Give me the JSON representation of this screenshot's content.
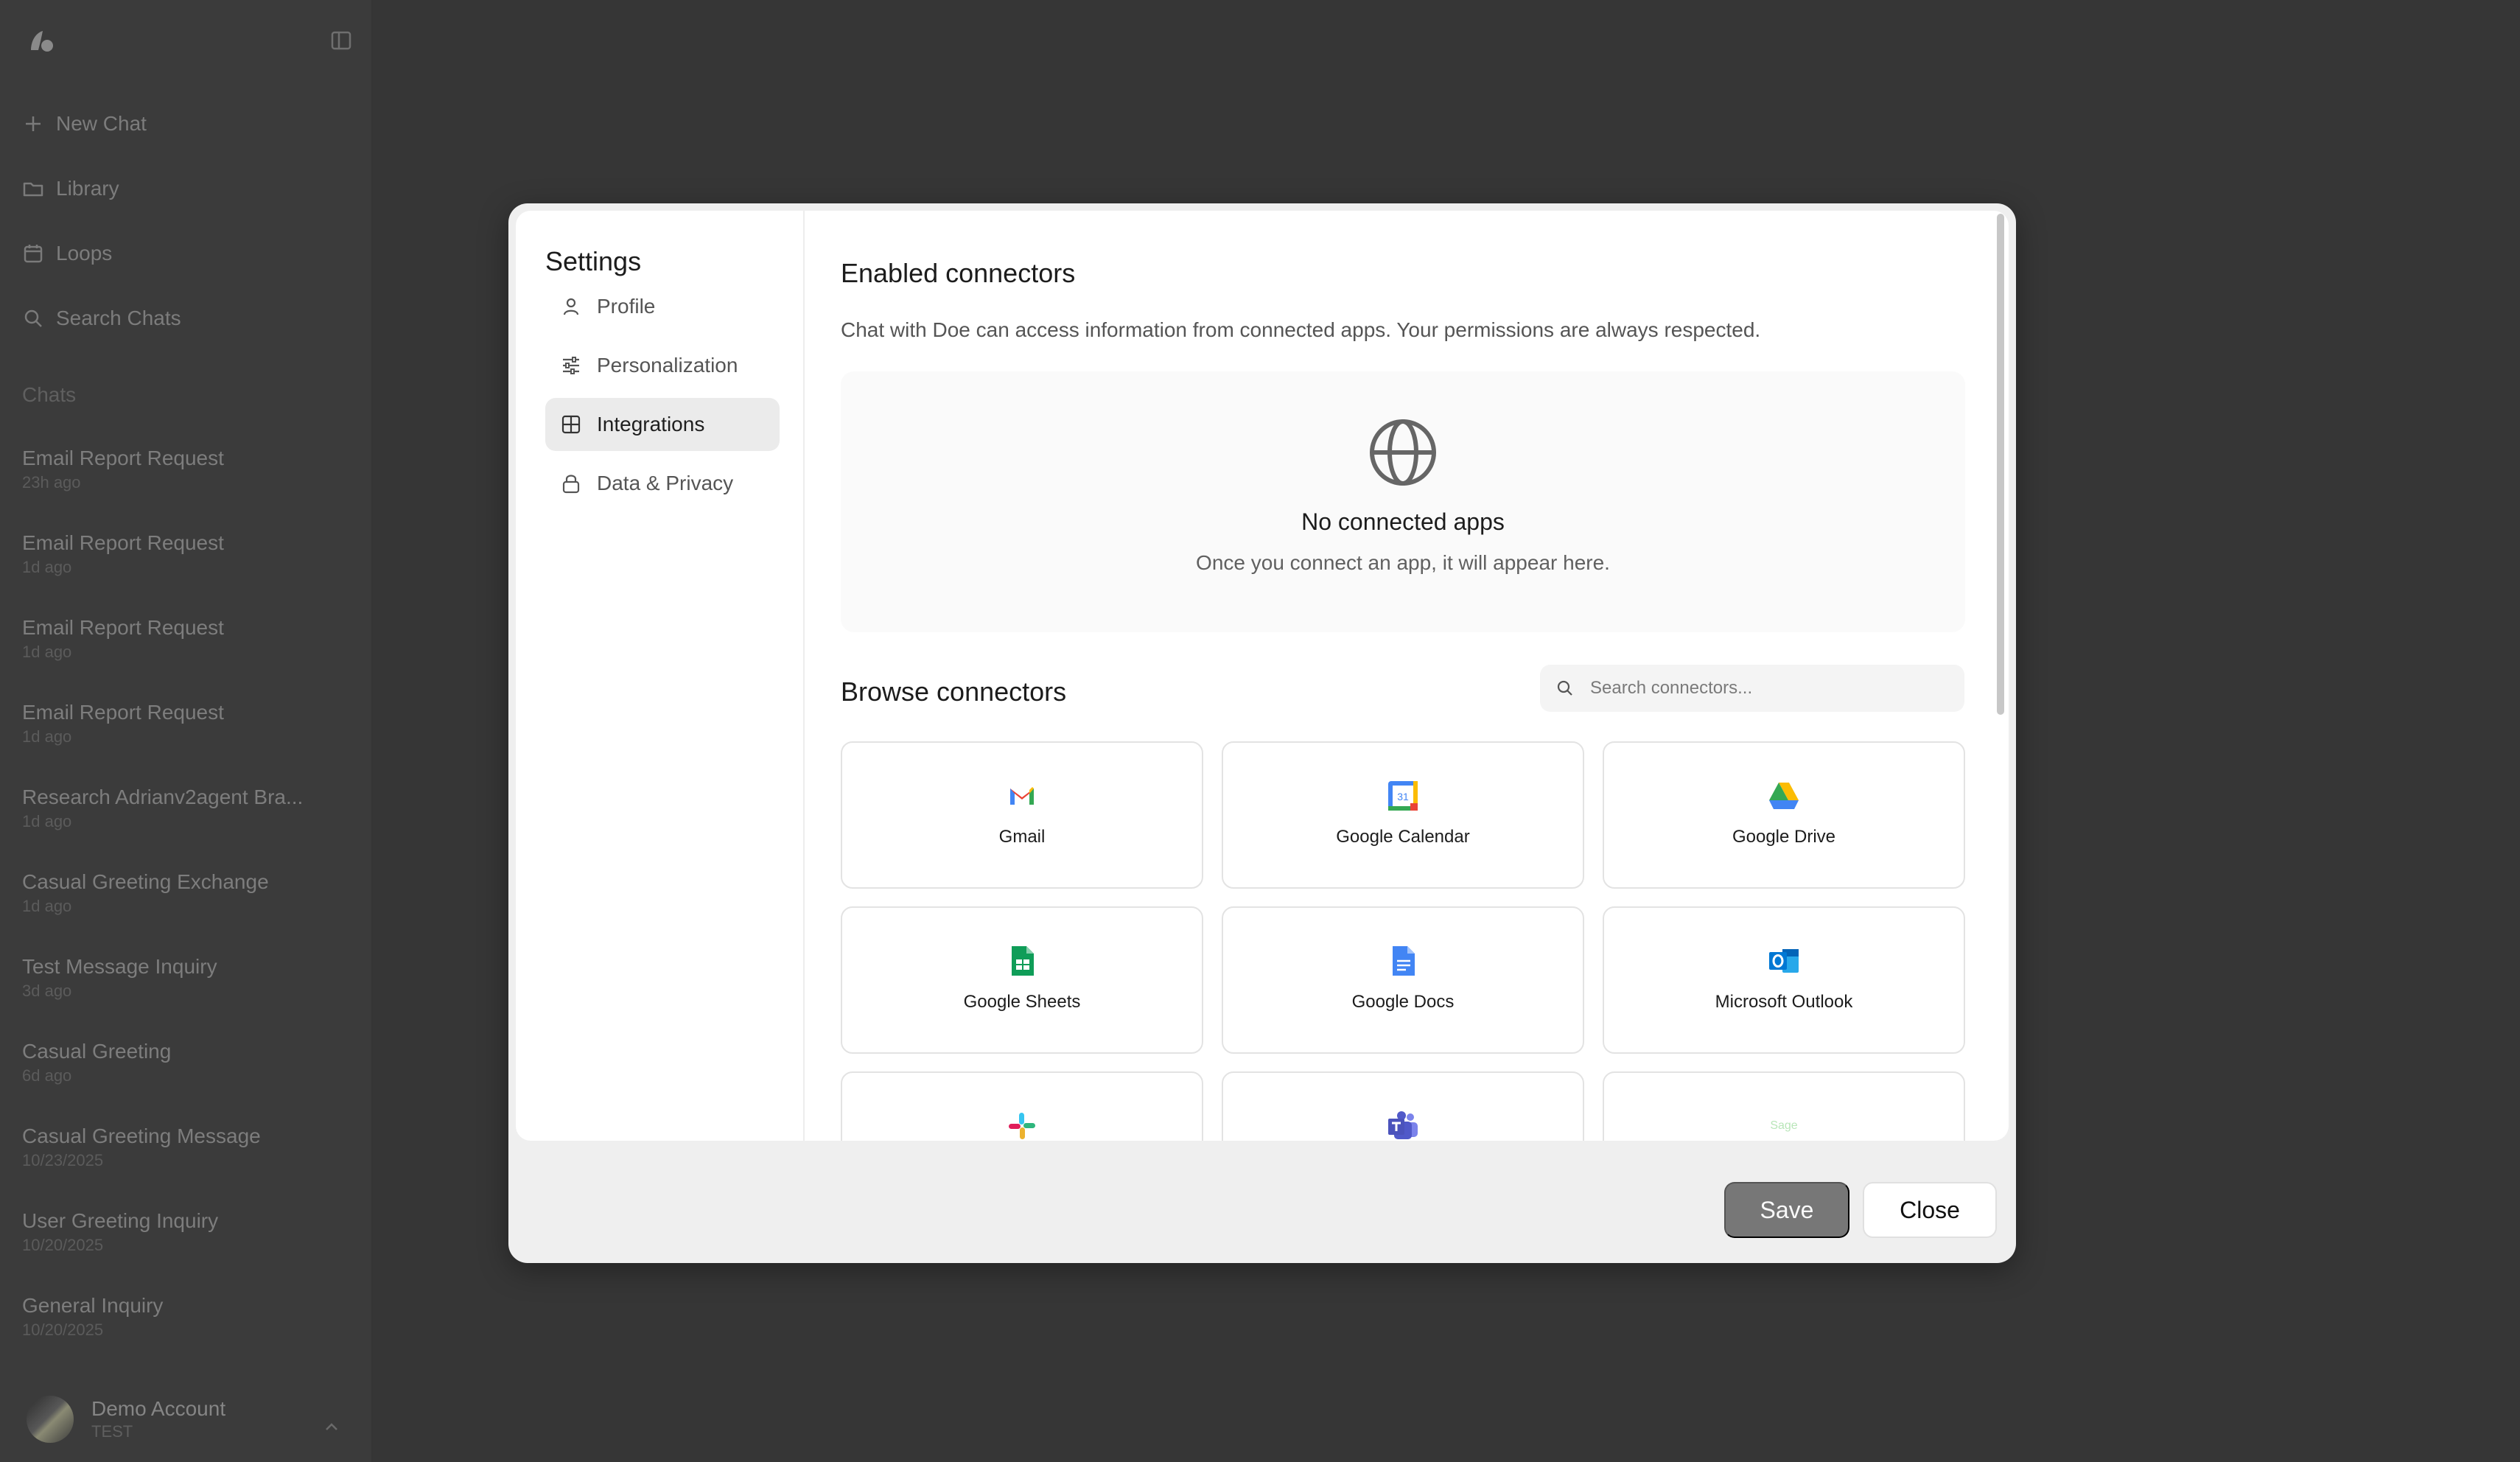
{
  "sidebar": {
    "new_chat": "New Chat",
    "library": "Library",
    "loops": "Loops",
    "search_chats": "Search Chats",
    "section_label": "Chats",
    "chats": [
      {
        "title": "Email Report Request",
        "time": "23h ago"
      },
      {
        "title": "Email Report Request",
        "time": "1d ago"
      },
      {
        "title": "Email Report Request",
        "time": "1d ago"
      },
      {
        "title": "Email Report Request",
        "time": "1d ago"
      },
      {
        "title": "Research Adrianv2agent Bra...",
        "time": "1d ago"
      },
      {
        "title": "Casual Greeting Exchange",
        "time": "1d ago"
      },
      {
        "title": "Test Message Inquiry",
        "time": "3d ago"
      },
      {
        "title": "Casual Greeting",
        "time": "6d ago"
      },
      {
        "title": "Casual Greeting Message",
        "time": "10/23/2025"
      },
      {
        "title": "User Greeting Inquiry",
        "time": "10/20/2025"
      },
      {
        "title": "General Inquiry",
        "time": "10/20/2025"
      }
    ],
    "account": {
      "name": "Demo Account",
      "sub": "TEST"
    }
  },
  "settings": {
    "title": "Settings",
    "nav": [
      {
        "label": "Profile",
        "icon": "user-icon"
      },
      {
        "label": "Personalization",
        "icon": "sliders-icon"
      },
      {
        "label": "Integrations",
        "icon": "grid-icon",
        "active": true
      },
      {
        "label": "Data & Privacy",
        "icon": "lock-icon"
      }
    ]
  },
  "integrations": {
    "enabled_title": "Enabled connectors",
    "description": "Chat with Doe can access information from connected apps. Your permissions are always respected.",
    "empty_title": "No connected apps",
    "empty_sub": "Once you connect an app, it will appear here.",
    "browse_title": "Browse connectors",
    "search_placeholder": "Search connectors...",
    "connectors": [
      {
        "label": "Gmail",
        "icon": "gmail-icon"
      },
      {
        "label": "Google Calendar",
        "icon": "google-calendar-icon"
      },
      {
        "label": "Google Drive",
        "icon": "google-drive-icon"
      },
      {
        "label": "Google Sheets",
        "icon": "google-sheets-icon"
      },
      {
        "label": "Google Docs",
        "icon": "google-docs-icon"
      },
      {
        "label": "Microsoft Outlook",
        "icon": "microsoft-outlook-icon"
      },
      {
        "label": "",
        "icon": "slack-icon"
      },
      {
        "label": "",
        "icon": "microsoft-teams-icon"
      },
      {
        "label": "",
        "icon": "sage-icon",
        "logo_text": "Sage"
      }
    ]
  },
  "footer": {
    "save": "Save",
    "close": "Close"
  },
  "colors": {
    "accent_save": "#777777",
    "overlay": "#3c3c3c"
  }
}
